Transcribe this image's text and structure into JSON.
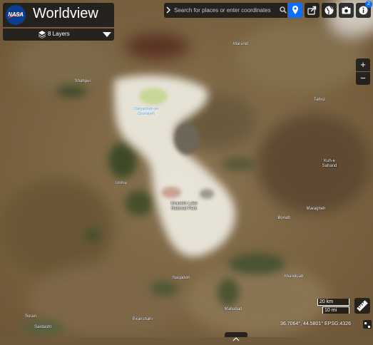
{
  "app": {
    "title": "Worldview",
    "logo_text": "NASA"
  },
  "layers": {
    "label": "8 Layers"
  },
  "search": {
    "placeholder": "Search for places or enter coordinates"
  },
  "toolbar": {
    "icons": [
      "share-icon",
      "projection-globe-icon",
      "camera-icon",
      "info-icon"
    ],
    "notification_count": "2"
  },
  "zoom": {
    "in_label": "+",
    "out_label": "−"
  },
  "scale": {
    "km": "20 km",
    "mi": "10 mi"
  },
  "coordinates": {
    "text": "36.7064°, 44.5801°   EPSG:4326"
  },
  "places": [
    {
      "name": "Marand",
      "type": "city"
    },
    {
      "name": "Shahpur",
      "type": "city"
    },
    {
      "name": "Tabriz",
      "type": "city"
    },
    {
      "name": "Daryacheh-ye Orumiyeh",
      "type": "water"
    },
    {
      "name": "Urmia",
      "type": "city"
    },
    {
      "name": "Kuh-e Sahand",
      "type": "peak"
    },
    {
      "name": "Urumieh Lake National Park",
      "type": "park"
    },
    {
      "name": "Bonab",
      "type": "city"
    },
    {
      "name": "Maragheh",
      "type": "city"
    },
    {
      "name": "Miandoab",
      "type": "city"
    },
    {
      "name": "Naqadeh",
      "type": "city"
    },
    {
      "name": "Mahabad",
      "type": "city"
    },
    {
      "name": "Piranshahr",
      "type": "city"
    },
    {
      "name": "Sardasht",
      "type": "city"
    },
    {
      "name": "Soran",
      "type": "city"
    }
  ],
  "colors": {
    "accent": "#0d6efd",
    "panel": "#181818",
    "terrain": "#7a6340",
    "lake": "#e6e2d8"
  }
}
